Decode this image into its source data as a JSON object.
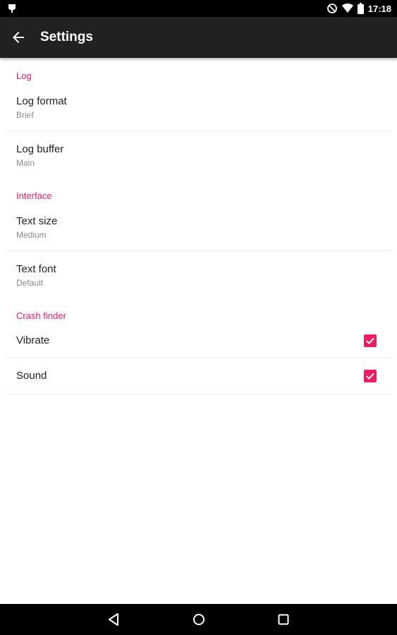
{
  "status_bar": {
    "time": "17:18",
    "icons": [
      "android-debug-icon",
      "do-not-disturb-icon",
      "wifi-icon",
      "battery-icon"
    ]
  },
  "app_bar": {
    "title": "Settings",
    "back_icon": "arrow-back-icon"
  },
  "sections": [
    {
      "header": "Log",
      "items": [
        {
          "title": "Log format",
          "summary": "Brief"
        },
        {
          "title": "Log buffer",
          "summary": "Main"
        }
      ]
    },
    {
      "header": "Interface",
      "items": [
        {
          "title": "Text size",
          "summary": "Medium"
        },
        {
          "title": "Text font",
          "summary": "Default"
        }
      ]
    },
    {
      "header": "Crash finder",
      "items": [
        {
          "title": "Vibrate",
          "checked": true
        },
        {
          "title": "Sound",
          "checked": true
        }
      ]
    }
  ],
  "nav_bar": {
    "icons": [
      "back-triangle-icon",
      "home-circle-icon",
      "recents-square-icon"
    ]
  },
  "colors": {
    "accent": "#e91e63",
    "app_bar": "#212121",
    "status_bar": "#000000"
  }
}
